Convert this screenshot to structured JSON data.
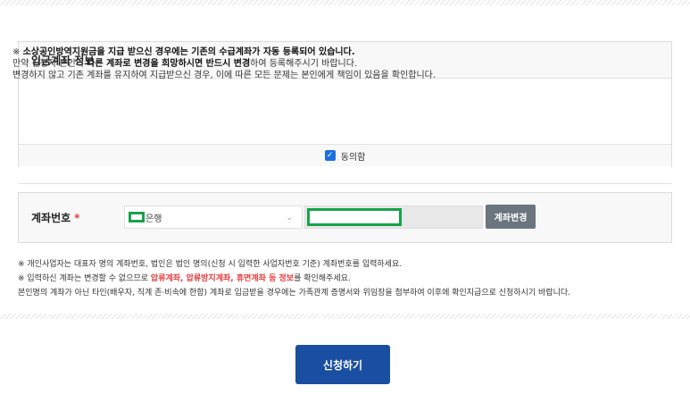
{
  "account_info": {
    "title": "입금계좌 정보",
    "notice_line1_pre": "※ ",
    "notice_line1_bold": "소상공인방역지원금을 지급 받으신 경우에는 기존의 수급계좌가 자동 등록되어 있습니다.",
    "notice_line2_pre": "만약 신청자 본인의 ",
    "notice_line2_bold": "다른 계좌로 변경을 희망하시면 반드시 변경",
    "notice_line2_post": "하여 등록해주시기 바랍니다.",
    "notice_line3": "변경하지 않고 기존 계좌를 유지하여 지급받으신 경우, 이에 따른 모든 문제는 본인에게 책임이 있음을 확인합니다.",
    "agree_label": "동의함",
    "agree_checked": true
  },
  "account": {
    "label": "계좌번호",
    "required_mark": "*",
    "bank_suffix": "은행",
    "change_button": "계좌변경"
  },
  "guide": {
    "line1": "※ 개인사업자는 대표자 명의 계좌번호, 법인은 법인 명의(신청 시 입력한 사업자번호 기준) 계좌번호를 입력하세요.",
    "line2_pre": "※ 입력하신 계좌는 변경할 수 없으므로 ",
    "line2_red": "압류계좌, 압류방지계좌, 휴면계좌 등 정보",
    "line2_post": "를 확인해주세요.",
    "line3": "본인명의 계좌가 아닌 타인(배우자, 직계 존·비속에 한함) 계좌로 입금받을 경우에는 가족관계 증명서와 위임장을 첨부하여 이후에 확인지급으로 신청하시기 바랍니다."
  },
  "submit_label": "신청하기",
  "colors": {
    "primary": "#1a4ea2",
    "checkbox": "#1b6fe0",
    "required": "#e83a3a",
    "highlight": "#16a34a",
    "change_button": "#6a757f"
  }
}
